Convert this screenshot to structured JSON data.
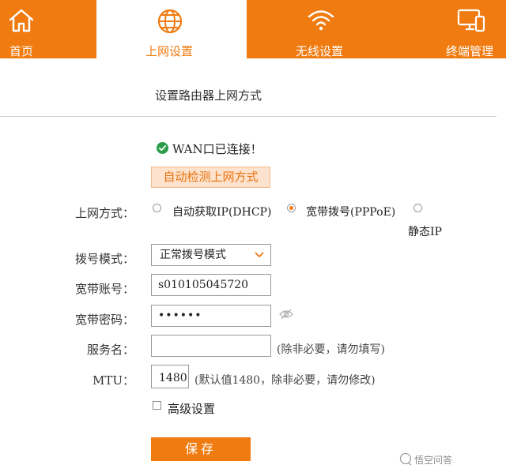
{
  "nav": {
    "items": [
      {
        "label": "首页",
        "icon": "home-icon"
      },
      {
        "label": "上网设置",
        "icon": "globe-icon",
        "active": true
      },
      {
        "label": "无线设置",
        "icon": "wifi-icon"
      },
      {
        "label": "终端管理",
        "icon": "devices-icon"
      }
    ]
  },
  "page": {
    "title": "设置路由器上网方式"
  },
  "status": {
    "text": "WAN口已连接！",
    "icon": "check-circle-icon",
    "color": "#2a9d4a"
  },
  "detect_button": {
    "label": "自动检测上网方式"
  },
  "form": {
    "connection": {
      "label": "上网方式：",
      "options": [
        {
          "label": "自动获取IP(DHCP)",
          "selected": false
        },
        {
          "label": "宽带拨号(PPPoE)",
          "selected": true
        },
        {
          "label": "静态IP",
          "selected": false
        }
      ]
    },
    "dial_mode": {
      "label": "拨号模式：",
      "value": "正常拨号模式"
    },
    "account": {
      "label": "宽带账号：",
      "value": "s010105045720"
    },
    "password": {
      "label": "宽带密码：",
      "value": "••••••"
    },
    "service": {
      "label": "服务名：",
      "value": "",
      "hint": "(除非必要，请勿填写)"
    },
    "mtu": {
      "label": "MTU：",
      "value": "1480",
      "hint": "(默认值1480，除非必要，请勿修改)"
    },
    "advanced": {
      "label": "高级设置",
      "checked": false
    }
  },
  "save_button": {
    "label": "保存"
  },
  "watermark": {
    "text": "悟空问答"
  },
  "colors": {
    "accent": "#f07b10",
    "detect_bg": "#fde3cd"
  }
}
